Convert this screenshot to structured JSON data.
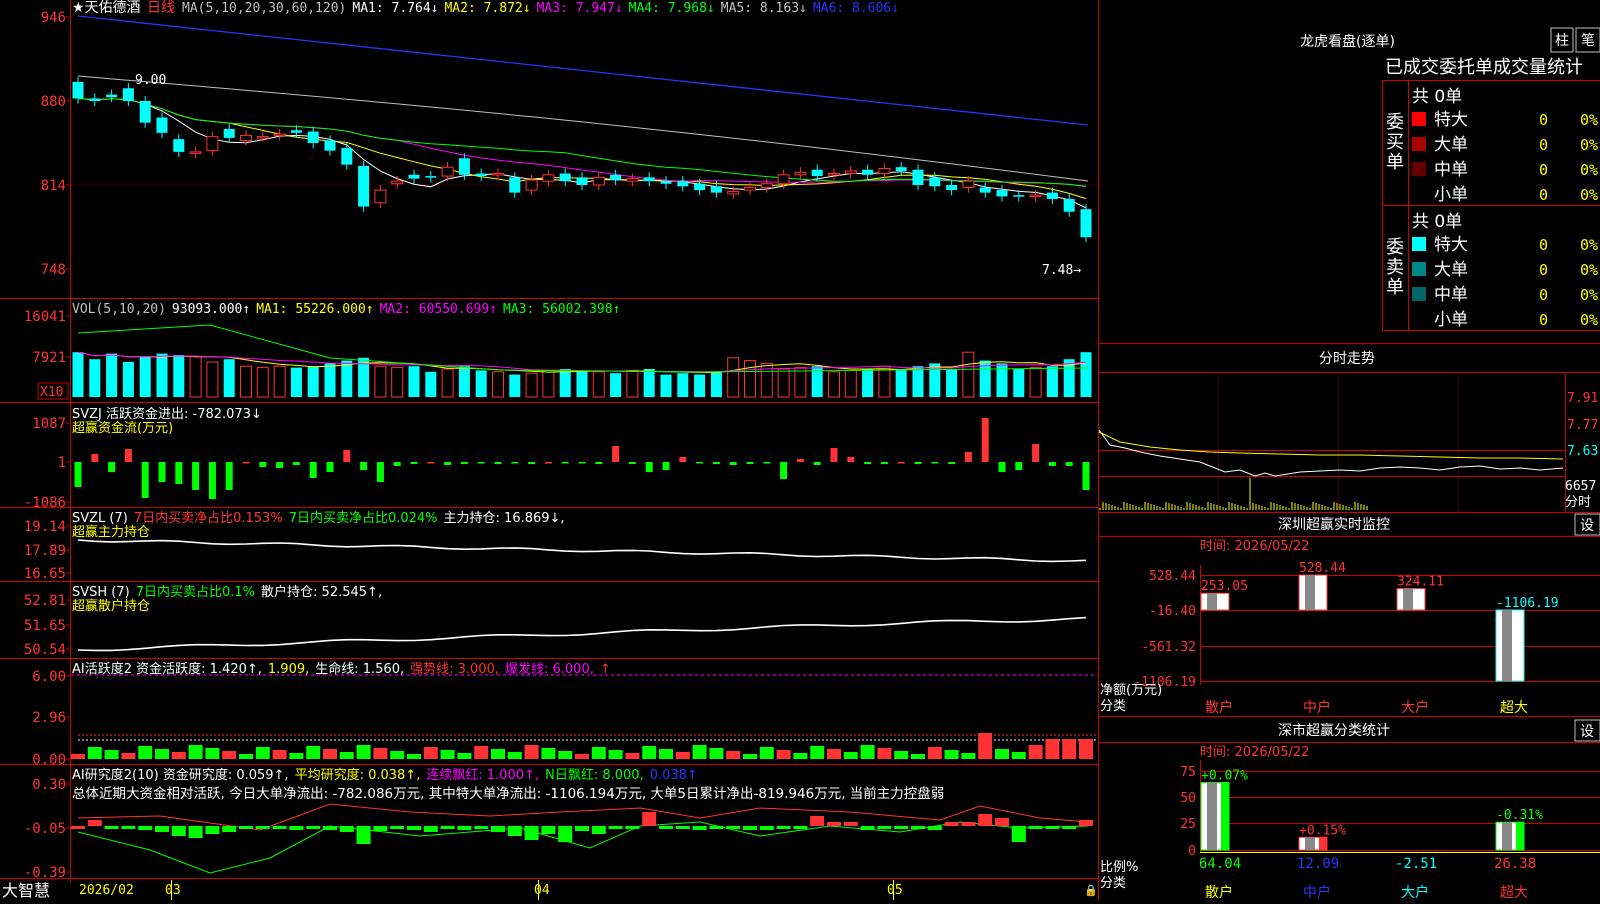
{
  "stock": {
    "name": "★天佑德酒",
    "period": "日线"
  },
  "colors": {
    "up": "#ff3333",
    "down": "#00ffff",
    "green": "#00ff00",
    "yellow": "#ffff00",
    "magenta": "#ff00ff",
    "blue": "#3030ff",
    "white": "#ffffff",
    "grey": "#c0c0c0",
    "frame": "#cc0000",
    "dim": "#00a0a0",
    "orange": "#ff6600"
  },
  "main": {
    "legend": [
      {
        "t": "MA(5,10,20,30,60,120)",
        "c": "#c0c0c0"
      },
      {
        "t": "MA1: 7.764↓",
        "c": "#ffffff"
      },
      {
        "t": "MA2: 7.872↓",
        "c": "#ffff00"
      },
      {
        "t": "MA3: 7.947↓",
        "c": "#ff00ff"
      },
      {
        "t": "MA4: 7.968↓",
        "c": "#00ff00"
      },
      {
        "t": "MA5: 8.163↓",
        "c": "#c0c0c0"
      },
      {
        "t": "MA6: 8.606↓",
        "c": "#3030ff"
      }
    ],
    "yticks": [
      "946",
      "880",
      "814",
      "748"
    ],
    "high_label": "9.00",
    "low_label": "7.48→"
  },
  "vol": {
    "legend": [
      {
        "t": "VOL(5,10,20)",
        "c": "#c0c0c0"
      },
      {
        "t": "93093.000↑",
        "c": "#ffffff"
      },
      {
        "t": "MA1: 55226.000↑",
        "c": "#ffff00"
      },
      {
        "t": "MA2: 60550.699↑",
        "c": "#ff00ff"
      },
      {
        "t": "MA3: 56002.398↑",
        "c": "#00ff00"
      }
    ],
    "yticks": [
      "16041",
      "7921"
    ],
    "unit": "X10"
  },
  "svzj": {
    "legend": [
      {
        "t": "SVZJ  活跃资金进出: -782.073↓",
        "c": "#ffffff"
      }
    ],
    "sub": "超赢资金流(万元)",
    "yticks": [
      "1087",
      "1",
      "-1086"
    ]
  },
  "svzl": {
    "legend": [
      {
        "t": "SVZL (7)",
        "c": "#ffffff"
      },
      {
        "t": "7日内买卖净占比0.153%",
        "c": "#ff3333"
      },
      {
        "t": "7日内买卖净占比0.024%",
        "c": "#00ff00"
      },
      {
        "t": "主力持仓: 16.869↓,",
        "c": "#ffffff"
      }
    ],
    "sub": "超赢主力持仓",
    "yticks": [
      "19.14",
      "17.89",
      "16.65"
    ]
  },
  "svsh": {
    "legend": [
      {
        "t": "SVSH (7)",
        "c": "#ffffff"
      },
      {
        "t": "7日内买卖占比0.1%",
        "c": "#00ff00"
      },
      {
        "t": "散户持仓: 52.545↑,",
        "c": "#ffffff"
      }
    ],
    "sub": "超赢散户持仓",
    "yticks": [
      "52.81",
      "51.65",
      "50.54"
    ]
  },
  "ai1": {
    "legend": [
      {
        "t": "AI活跃度2 资金活跃度: 1.420↑,",
        "c": "#ffffff"
      },
      {
        "t": "1.909,",
        "c": "#ffff00"
      },
      {
        "t": "生命线: 1.560,",
        "c": "#ffffff"
      },
      {
        "t": "强势线: 3.000,",
        "c": "#ff3333"
      },
      {
        "t": "爆发线: 6.000,",
        "c": "#ff00ff"
      },
      {
        "t": "↑",
        "c": "#ff3333"
      }
    ],
    "yticks": [
      "6.00",
      "2.96",
      "0.00"
    ]
  },
  "ai2": {
    "legend": [
      {
        "t": "AI研究度2(10) 资金研究度: 0.059↑,",
        "c": "#ffffff"
      },
      {
        "t": "平均研究度: 0.038↑,",
        "c": "#ffff00"
      },
      {
        "t": "连续飘红: 1.000↑,",
        "c": "#ff00ff"
      },
      {
        "t": "N日飘红: 8.000,",
        "c": "#00ff00"
      },
      {
        "t": "0.038↑",
        "c": "#3030ff"
      }
    ],
    "summary": "总体近期大资金相对活跃, 今日大单净流出: -782.086万元, 其中特大单净流出: -1106.194万元, 大单5日累计净出-819.946万元, 当前主力控盘弱",
    "yticks": [
      "0.30",
      "-0.05",
      "-0.39"
    ]
  },
  "xaxis": {
    "brand": "大智慧",
    "labels": [
      {
        "t": "2026/02",
        "c": "#ffff00"
      },
      {
        "t": "03",
        "c": "#ffff00"
      },
      {
        "t": "04",
        "c": "#ffff00"
      },
      {
        "t": "05",
        "c": "#ffff00"
      }
    ]
  },
  "lhb": {
    "title": "龙虎看盘(逐单)",
    "tabs": [
      "柱",
      "笔"
    ],
    "subtitle": "已成交委托单成交量统计",
    "buy": {
      "side": "委买单",
      "total": "共 0单",
      "rows": [
        {
          "name": "特大",
          "qty": "0",
          "pct": "0%",
          "color": "#ff0000"
        },
        {
          "name": "大单",
          "qty": "0",
          "pct": "0%",
          "color": "#aa0000"
        },
        {
          "name": "中单",
          "qty": "0",
          "pct": "0%",
          "color": "#660000"
        },
        {
          "name": "小单",
          "qty": "0",
          "pct": "0%",
          "color": "#000000"
        }
      ]
    },
    "sell": {
      "side": "委卖单",
      "total": "共 0单",
      "rows": [
        {
          "name": "特大",
          "qty": "0",
          "pct": "0%",
          "color": "#00ffff"
        },
        {
          "name": "大单",
          "qty": "0",
          "pct": "0%",
          "color": "#008888"
        },
        {
          "name": "中单",
          "qty": "0",
          "pct": "0%",
          "color": "#006666"
        },
        {
          "name": "小单",
          "qty": "0",
          "pct": "0%",
          "color": "#000000"
        }
      ]
    }
  },
  "intraday": {
    "title": "分时走势",
    "yticks": [
      "7.91",
      "7.77",
      "7.63",
      "6657"
    ],
    "unit": "分时"
  },
  "monitor": {
    "title": "深圳超赢实时监控",
    "settings": "设",
    "time": "时间: 2026/05/22",
    "yticks": [
      "528.44",
      "-16.40",
      "-561.32",
      "-1106.19"
    ],
    "ylabel": "净额(万元)",
    "xlabel": "分类",
    "categories": [
      {
        "name": "散户",
        "value": "253.05",
        "v": 253.05
      },
      {
        "name": "中户",
        "value": "528.44",
        "v": 528.44
      },
      {
        "name": "大户",
        "value": "324.11",
        "v": 324.11
      },
      {
        "name": "超大",
        "value": "-1106.19",
        "v": -1106.19
      }
    ]
  },
  "ratio": {
    "title": "深市超赢分类统计",
    "settings": "设",
    "time": "时间: 2026/05/22",
    "yticks": [
      "75",
      "50",
      "25",
      "0"
    ],
    "ylabel": "比例%",
    "xlabel": "分类",
    "categories": [
      {
        "name": "散户",
        "value": "64.04",
        "change": "+0.07%",
        "v": 64.04,
        "color": "#00ff00",
        "vc": "#00ff00"
      },
      {
        "name": "中户",
        "value": "12.09",
        "change": "+0.15%",
        "v": 12.09,
        "color": "#ff3333",
        "vc": "#3030ff"
      },
      {
        "name": "大户",
        "value": "-2.51",
        "change": "",
        "v": -2.51,
        "color": "#ffffff",
        "vc": "#00ffff"
      },
      {
        "name": "超大",
        "value": "26.38",
        "change": "-0.31%",
        "v": 26.38,
        "color": "#00ff00",
        "vc": "#ff3333"
      }
    ]
  }
}
